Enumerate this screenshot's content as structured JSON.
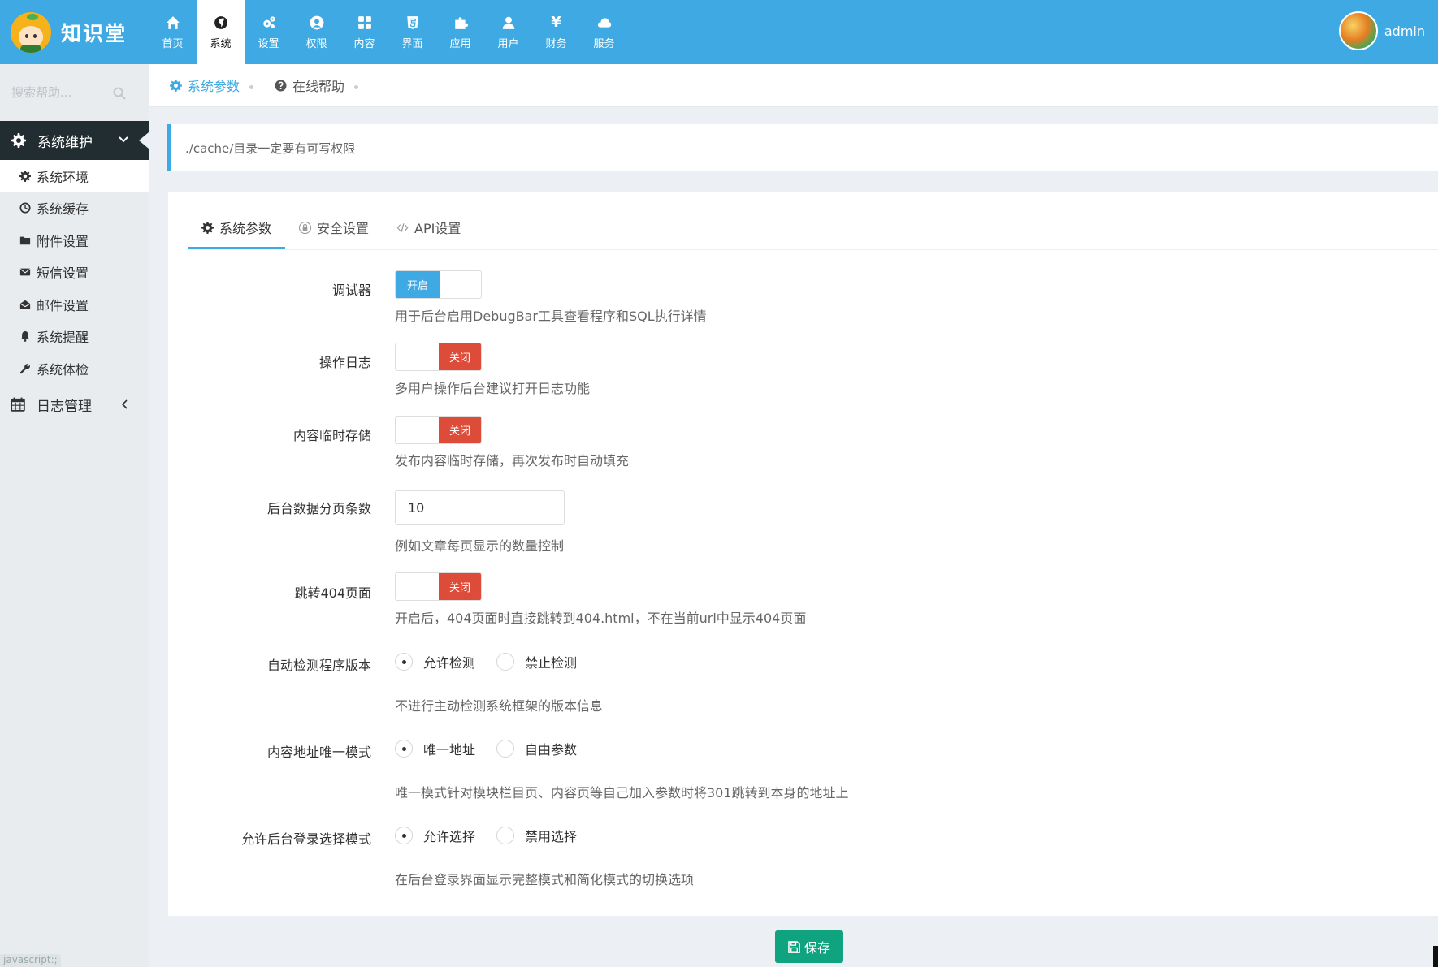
{
  "brand": {
    "name": "知识堂"
  },
  "nav": [
    {
      "label": "首页",
      "icon": "home-icon"
    },
    {
      "label": "系统",
      "icon": "globe-icon",
      "active": true
    },
    {
      "label": "设置",
      "icon": "cogs-icon"
    },
    {
      "label": "权限",
      "icon": "user-circle-icon"
    },
    {
      "label": "内容",
      "icon": "grid-icon"
    },
    {
      "label": "界面",
      "icon": "html5-icon"
    },
    {
      "label": "应用",
      "icon": "puzzle-icon"
    },
    {
      "label": "用户",
      "icon": "user-icon"
    },
    {
      "label": "财务",
      "icon": "yen-icon"
    },
    {
      "label": "服务",
      "icon": "cloud-icon"
    }
  ],
  "user": {
    "name": "admin"
  },
  "sidebar": {
    "search_placeholder": "搜索帮助...",
    "group_label": "系统维护",
    "items": [
      {
        "label": "系统环境",
        "icon": "gear-icon",
        "active": true
      },
      {
        "label": "系统缓存",
        "icon": "clock-icon"
      },
      {
        "label": "附件设置",
        "icon": "folder-icon"
      },
      {
        "label": "短信设置",
        "icon": "envelope-icon"
      },
      {
        "label": "邮件设置",
        "icon": "envelope-open-icon"
      },
      {
        "label": "系统提醒",
        "icon": "bell-icon"
      },
      {
        "label": "系统体检",
        "icon": "wrench-icon"
      }
    ],
    "log_label": "日志管理",
    "status_text": "javascript:;"
  },
  "breadcrumbs": [
    {
      "label": "系统参数",
      "active": true
    },
    {
      "label": "在线帮助"
    }
  ],
  "notice": "./cache/目录一定要有可写权限",
  "tabs": [
    {
      "label": "系统参数",
      "active": true
    },
    {
      "label": "安全设置"
    },
    {
      "label": "API设置"
    }
  ],
  "form": {
    "debugger": {
      "label": "调试器",
      "state": "开启",
      "help": "用于后台启用DebugBar工具查看程序和SQL执行详情"
    },
    "oplog": {
      "label": "操作日志",
      "state": "关闭",
      "help": "多用户操作后台建议打开日志功能"
    },
    "draft": {
      "label": "内容临时存储",
      "state": "关闭",
      "help": "发布内容临时存储，再次发布时自动填充"
    },
    "pagesize": {
      "label": "后台数据分页条数",
      "value": "10",
      "help": "例如文章每页显示的数量控制"
    },
    "jump404": {
      "label": "跳转404页面",
      "state": "关闭",
      "help": "开启后，404页面时直接跳转到404.html，不在当前url中显示404页面"
    },
    "autocheck": {
      "label": "自动检测程序版本",
      "opt1": "允许检测",
      "opt2": "禁止检测",
      "selected": "允许检测",
      "help": "不进行主动检测系统框架的版本信息"
    },
    "uniqueurl": {
      "label": "内容地址唯一模式",
      "opt1": "唯一地址",
      "opt2": "自由参数",
      "selected": "唯一地址",
      "help": "唯一模式针对模块栏目页、内容页等自己加入参数时将301跳转到本身的地址上"
    },
    "loginmode": {
      "label": "允许后台登录选择模式",
      "opt1": "允许选择",
      "opt2": "禁用选择",
      "selected": "允许选择",
      "help": "在后台登录界面显示完整模式和简化模式的切换选项"
    }
  },
  "save_label": "保存",
  "colors": {
    "primary": "#3fa9e3",
    "danger": "#dd4b39",
    "success": "#10a37f",
    "sidebar_dark": "#222d32"
  }
}
